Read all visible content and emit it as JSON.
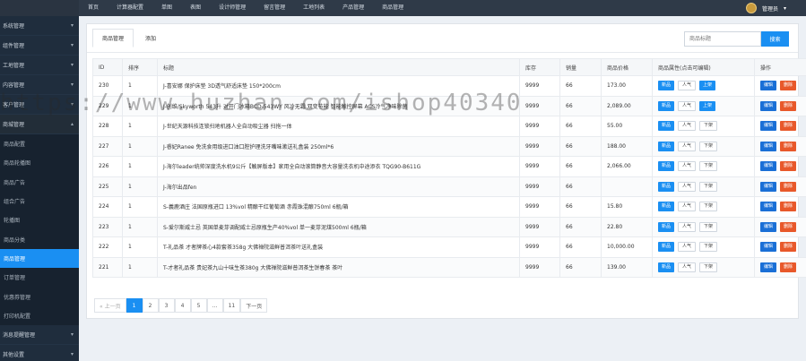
{
  "topnav": [
    "首页",
    "计算器配置",
    "单图",
    "表图",
    "设计师管理",
    "留言管理",
    "工地列表",
    "产品管理",
    "商品管理"
  ],
  "user": {
    "name": "管理员",
    "caret": "▾"
  },
  "sidebar": {
    "groups_top": [
      {
        "label": "系统管理"
      },
      {
        "label": "组件管理"
      },
      {
        "label": "工地管理"
      },
      {
        "label": "内容管理"
      },
      {
        "label": "客户管理"
      },
      {
        "label": "商城管理"
      }
    ],
    "subs": [
      {
        "label": "商品配置"
      },
      {
        "label": "商品轮播图"
      },
      {
        "label": "商品广告"
      },
      {
        "label": "组合广告"
      },
      {
        "label": "轮播图"
      },
      {
        "label": "商品分类"
      },
      {
        "label": "商品管理"
      },
      {
        "label": "订单管理"
      },
      {
        "label": "优惠券管理"
      },
      {
        "label": "打印机配置"
      }
    ],
    "groups_bottom": [
      {
        "label": "消息提醒管理"
      },
      {
        "label": "其他设置"
      }
    ]
  },
  "tabs": [
    "商品管理",
    "添加"
  ],
  "search": {
    "placeholder": "商品标题",
    "button": "搜索"
  },
  "table": {
    "headers": [
      "ID",
      "排序",
      "标题",
      "库存",
      "销量",
      "商品价格",
      "商品属性(点击可编辑)",
      "操作"
    ],
    "rows": [
      {
        "id": "230",
        "sort": "1",
        "title": "J-喜安娜 保护床垫 3D透气舒适床垫 150*200cm",
        "stock": "9999",
        "sales": "66",
        "price": "173.00",
        "shelf": "上架"
      },
      {
        "id": "229",
        "sort": "1",
        "title": "J-创维/Skyworth 543升 对开门冰箱BCD-543WY 风冷无霜 双变节能 智能触控屏幕 ACS冷气净味除菌",
        "stock": "9999",
        "sales": "66",
        "price": "2,089.00",
        "shelf": "上架"
      },
      {
        "id": "228",
        "sort": "1",
        "title": "J-世纪天源科技连锁扫地机器人全自动吸尘器 扫拖一体",
        "stock": "9999",
        "sales": "66",
        "price": "55.00",
        "shelf": "下架"
      },
      {
        "id": "227",
        "sort": "1",
        "title": "J-睿妃Ranee 免洗食用级进口油口腔护理洗牙嘴味漱送礼盒装 250ml*6",
        "stock": "9999",
        "sales": "66",
        "price": "188.00",
        "shelf": "下架"
      },
      {
        "id": "226",
        "sort": "1",
        "title": "J-海尔leader统帅深度洗水机9公斤【触屏版本】家用全自动滚筒静音大容量洗衣机中途添衣 TQG90-B611G",
        "stock": "9999",
        "sales": "66",
        "price": "2,066.00",
        "shelf": "下架"
      },
      {
        "id": "225",
        "sort": "1",
        "title": "J-海尔出品fen",
        "stock": "9999",
        "sales": "66",
        "price": "",
        "shelf": "下架"
      },
      {
        "id": "224",
        "sort": "1",
        "title": "S-義鹿酒庄 法国原瓶进口 13%vol 精酿干红葡萄酒 赤霞珠混酿750ml 6瓶/箱",
        "stock": "9999",
        "sales": "66",
        "price": "15.80",
        "shelf": "下架"
      },
      {
        "id": "223",
        "sort": "1",
        "title": "S-爱尔斯威士忌 英国单麦芽调配威士忌原瓶生产40%vol 单一麦芽泥煤500ml 6瓶/箱",
        "stock": "9999",
        "sales": "66",
        "price": "22.80",
        "shelf": "下架"
      },
      {
        "id": "222",
        "sort": "1",
        "title": "T-礼品茶 才者牌茶心4款套茶358g 大佛禅院滋鲜普洱茶叶送礼盒装",
        "stock": "9999",
        "sales": "66",
        "price": "10,000.00",
        "shelf": "下架"
      },
      {
        "id": "221",
        "sort": "1",
        "title": "T-才者礼品茶 贵妃茶九山十味生茶380g 大佛禅院滋鲜普洱茶生饼春茶 茶叶",
        "stock": "9999",
        "sales": "66",
        "price": "139.00",
        "shelf": "下架"
      }
    ],
    "attr_buttons": {
      "recommend": "新品",
      "hot": "人气"
    },
    "actions": {
      "edit": "编辑",
      "delete": "删除"
    }
  },
  "pagination": {
    "prev": "« 上一页",
    "pages": [
      "1",
      "2",
      "3",
      "4",
      "5",
      "...",
      "11"
    ],
    "next": "下一页",
    "current": "1"
  },
  "watermark": "https://www.huzhan.com/ishop40340",
  "colors": {
    "accent": "#1a8ff2",
    "danger": "#e8582a",
    "sidebar": "#1f2d3d",
    "topbar": "#2f3a48"
  }
}
